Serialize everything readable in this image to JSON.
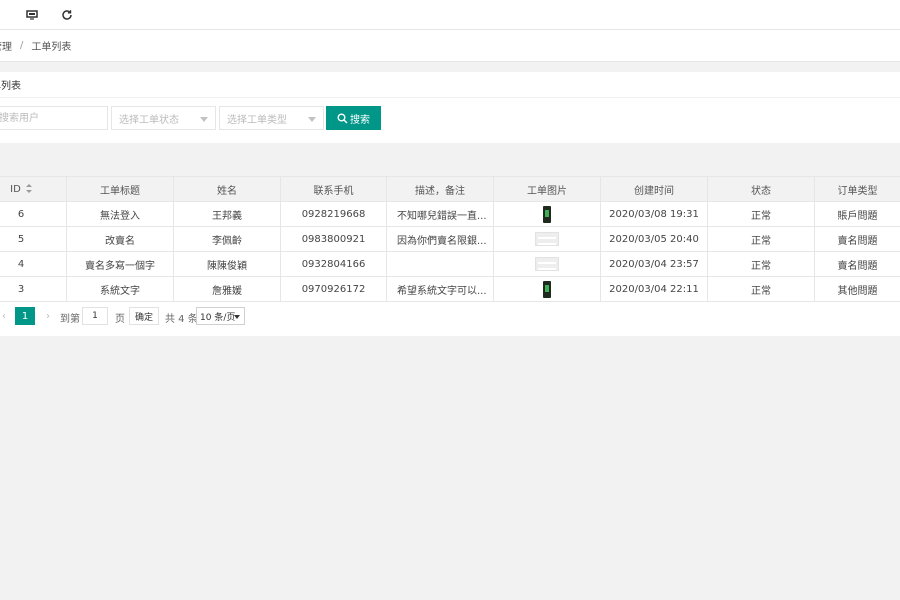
{
  "topbar": {
    "icons": [
      "screen-icon",
      "refresh-icon"
    ]
  },
  "breadcrumb": {
    "items": [
      "管理",
      "工单列表"
    ],
    "separator": "/"
  },
  "card": {
    "title": "单列表"
  },
  "filters": {
    "search_placeholder": "搜索用户",
    "status_placeholder": "选择工单状态",
    "type_placeholder": "选择工单类型",
    "search_button": "搜索"
  },
  "table": {
    "columns": [
      "ID",
      "工单标题",
      "姓名",
      "联系手机",
      "描述，备注",
      "工单图片",
      "创建时间",
      "状态",
      "订单类型"
    ],
    "rows": [
      {
        "id": "6",
        "title": "無法登入",
        "name": "王邦義",
        "phone": "0928219668",
        "desc": "不知哪兒錯誤一直...",
        "image": "phone",
        "created": "2020/03/08 19:31",
        "status": "正常",
        "type": "賬戶問題"
      },
      {
        "id": "5",
        "title": "改賣名",
        "name": "李佩齡",
        "phone": "0983800921",
        "desc": "因為你們賣名限銀...",
        "image": "placeholder",
        "created": "2020/03/05 20:40",
        "status": "正常",
        "type": "賣名問題"
      },
      {
        "id": "4",
        "title": "賣名多寫一個字",
        "name": "陳陳俊穎",
        "phone": "0932804166",
        "desc": "",
        "image": "placeholder",
        "created": "2020/03/04 23:57",
        "status": "正常",
        "type": "賣名問題"
      },
      {
        "id": "3",
        "title": "系統文字",
        "name": "詹雅媛",
        "phone": "0970926172",
        "desc": "希望系統文字可以...",
        "image": "phone",
        "created": "2020/03/04 22:11",
        "status": "正常",
        "type": "其他問題"
      }
    ]
  },
  "pagination": {
    "current_page": "1",
    "goto_label": "到第",
    "page_input_value": "1",
    "page_unit": "页",
    "confirm_label": "确定",
    "total_label": "共 4 条",
    "page_size": "10 条/页"
  },
  "colors": {
    "accent": "#009688",
    "header_bg": "#f2f2f2",
    "border": "#e6e6e6"
  }
}
